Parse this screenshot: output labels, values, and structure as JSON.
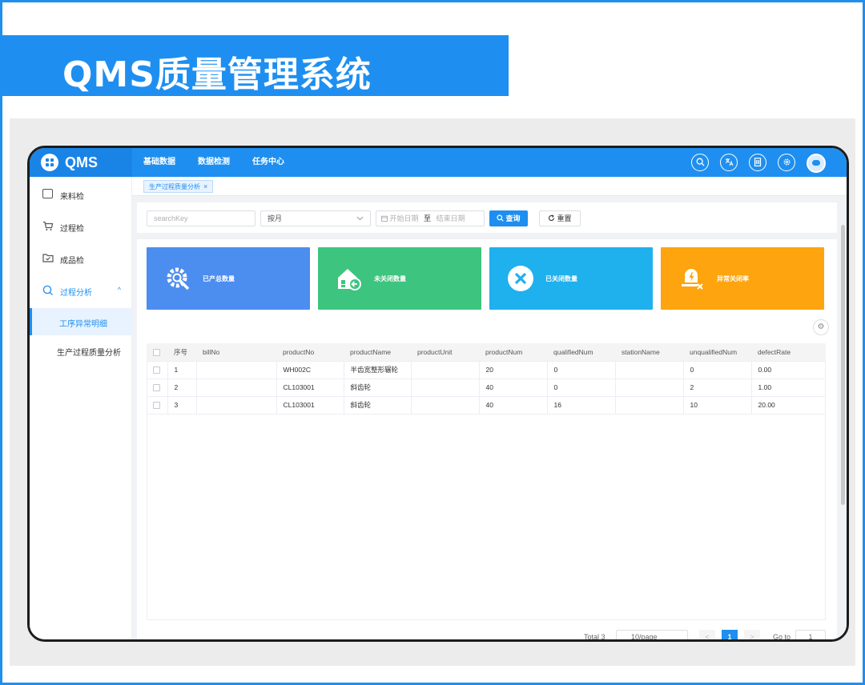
{
  "banner": {
    "title": "QMS质量管理系统"
  },
  "app": {
    "logo_text": "QMS"
  },
  "topnav": [
    "基础数据",
    "数据检测",
    "任务中心"
  ],
  "sidebar": {
    "items": [
      {
        "label": "来料检"
      },
      {
        "label": "过程检"
      },
      {
        "label": "成品检"
      },
      {
        "label": "过程分析"
      }
    ],
    "caret": "^",
    "subitems": [
      {
        "label": "工序异常明细"
      },
      {
        "label": "生产过程质量分析"
      }
    ]
  },
  "tags": {
    "current": "生产过程质量分析",
    "close": "×"
  },
  "filter": {
    "search_placeholder": "searchKey",
    "period_value": "按月",
    "date_start_placeholder": "开始日期",
    "date_sep": "至",
    "date_end_placeholder": "结束日期",
    "query_label": "查询",
    "reset_label": "重置"
  },
  "stats": [
    {
      "label": "已产总数量",
      "color": "#4c8df0"
    },
    {
      "label": "未关闭数量",
      "color": "#3dc47e"
    },
    {
      "label": "已关闭数量",
      "color": "#1fb0ee"
    },
    {
      "label": "异常关闭率",
      "color": "#fda40e"
    }
  ],
  "table": {
    "columns": [
      "序号",
      "billNo",
      "productNo",
      "productName",
      "productUnit",
      "productNum",
      "qualifiedNum",
      "stationName",
      "unqualifiedNum",
      "defectRate"
    ],
    "rows": [
      [
        "1",
        "",
        "WH002C",
        "半齿宽整形辗轮",
        "",
        "20",
        "0",
        "",
        "0",
        "0.00"
      ],
      [
        "2",
        "",
        "CL103001",
        "斜齿轮",
        "",
        "40",
        "0",
        "",
        "2",
        "1.00"
      ],
      [
        "3",
        "",
        "CL103001",
        "斜齿轮",
        "",
        "40",
        "16",
        "",
        "10",
        "20.00"
      ]
    ]
  },
  "pager": {
    "total": "Total 3",
    "page_size": "10/page",
    "current_page": "1",
    "goto_label": "Go to",
    "goto_value": "1",
    "prev": "<",
    "next": ">"
  },
  "colors": {
    "primary": "#1e8ff0"
  }
}
